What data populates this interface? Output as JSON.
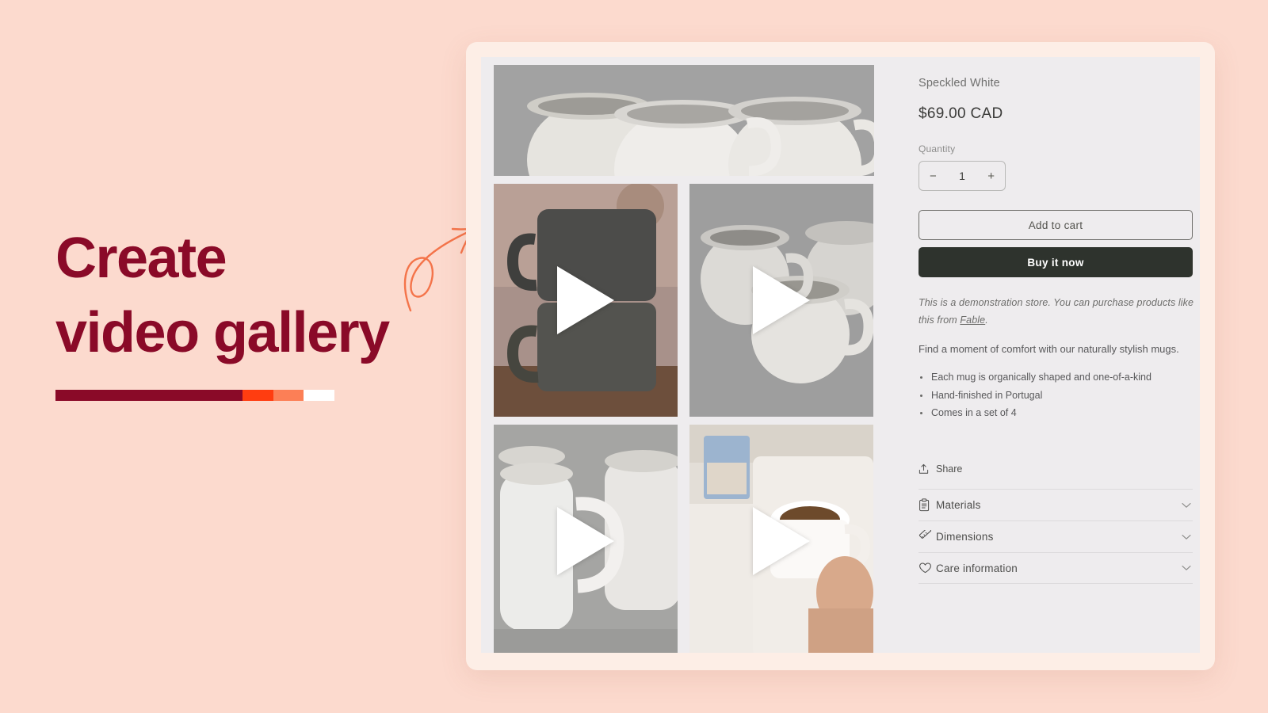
{
  "theme": {
    "page_bg": "#fcdace",
    "headline_color": "#8a0a28",
    "accent_orange": "#ff3d10",
    "accent_salmon": "#fc7f56",
    "arrow_color": "#f4744a",
    "card_bg": "#fdeee6",
    "panel_bg": "#eeecee",
    "primary_button_bg": "#2e332d"
  },
  "promo": {
    "headline": "Create\nvideo gallery",
    "progress_segments": [
      {
        "name": "segment-maroon",
        "color": "#8a0a28",
        "width_pct": 67
      },
      {
        "name": "segment-orange",
        "color": "#ff3d10",
        "width_pct": 11
      },
      {
        "name": "segment-salmon",
        "color": "#fc7f56",
        "width_pct": 11
      },
      {
        "name": "segment-white",
        "color": "#ffffff",
        "width_pct": 11
      }
    ],
    "arrow_icon": "curly-arrow-up-right-icon"
  },
  "gallery": {
    "hero": {
      "name": "hero-image",
      "alt": "Four speckled white ceramic mugs arranged together",
      "is_video": false
    },
    "tiles": [
      {
        "name": "video-thumbnail-1",
        "alt": "Two stacked speckled mugs on a wooden table",
        "is_video": true,
        "play_icon": "play-icon"
      },
      {
        "name": "video-thumbnail-2",
        "alt": "Group of white mugs on a grey surface",
        "is_video": true,
        "play_icon": "play-icon"
      },
      {
        "name": "video-thumbnail-3",
        "alt": "Close up of white mug handles",
        "is_video": true,
        "play_icon": "play-icon"
      },
      {
        "name": "video-thumbnail-4",
        "alt": "Hand holding a mug of coffee over a bed tray with a magazine",
        "is_video": true,
        "play_icon": "play-icon"
      }
    ]
  },
  "product": {
    "variant_name": "Speckled White",
    "price": "$69.00 CAD",
    "quantity_label": "Quantity",
    "quantity_value": "1",
    "quantity_decrease": "−",
    "quantity_increase": "+",
    "add_to_cart_label": "Add to cart",
    "buy_now_label": "Buy it now",
    "demo_note_part1": "This is a demonstration store. You can purchase products like this from ",
    "demo_note_link": "Fable",
    "demo_note_part2": ".",
    "description_lead": "Find a moment of comfort with our naturally stylish mugs.",
    "bullets": [
      "Each mug is organically shaped and one-of-a-kind",
      "Hand-finished in Portugal",
      "Comes in a set of 4"
    ],
    "share_label": "Share",
    "share_icon": "share-upload-icon",
    "accordion": [
      {
        "label": "Materials",
        "icon": "clipboard-icon",
        "chevron": "chevron-down-icon"
      },
      {
        "label": "Dimensions",
        "icon": "ruler-icon",
        "chevron": "chevron-down-icon"
      },
      {
        "label": "Care information",
        "icon": "heart-icon",
        "chevron": "chevron-down-icon"
      }
    ]
  }
}
